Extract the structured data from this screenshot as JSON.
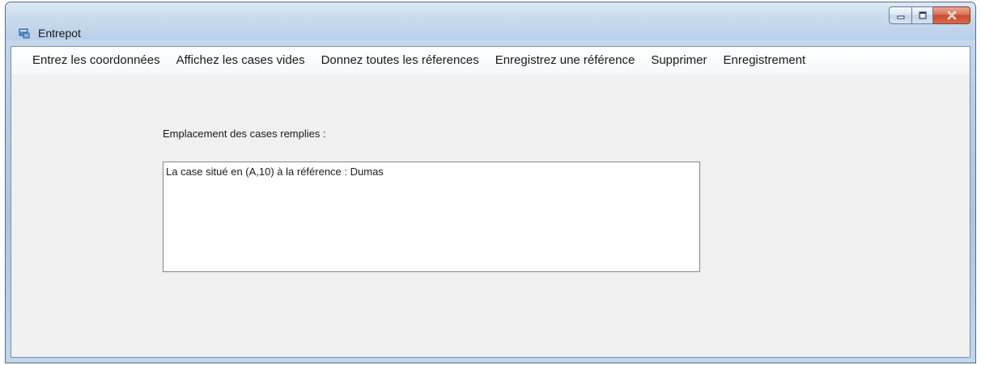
{
  "window": {
    "title": "Entrepot",
    "icon": "app-window-icon",
    "controls": [
      "minimize",
      "maximize",
      "close"
    ]
  },
  "menu": {
    "items": [
      {
        "label": "Entrez les coordonnées"
      },
      {
        "label": "Affichez les cases vides"
      },
      {
        "label": "Donnez toutes les réferences"
      },
      {
        "label": "Enregistrez une référence"
      },
      {
        "label": "Supprimer"
      },
      {
        "label": "Enregistrement"
      }
    ]
  },
  "main": {
    "label": "Emplacement des cases remplies :",
    "list_items": [
      "La case situé en (A,10) à la référence : Dumas"
    ]
  },
  "colors": {
    "client_bg": "#f0f0f0",
    "close_button": "#c84a2e",
    "title_bar": "#c8daee"
  }
}
